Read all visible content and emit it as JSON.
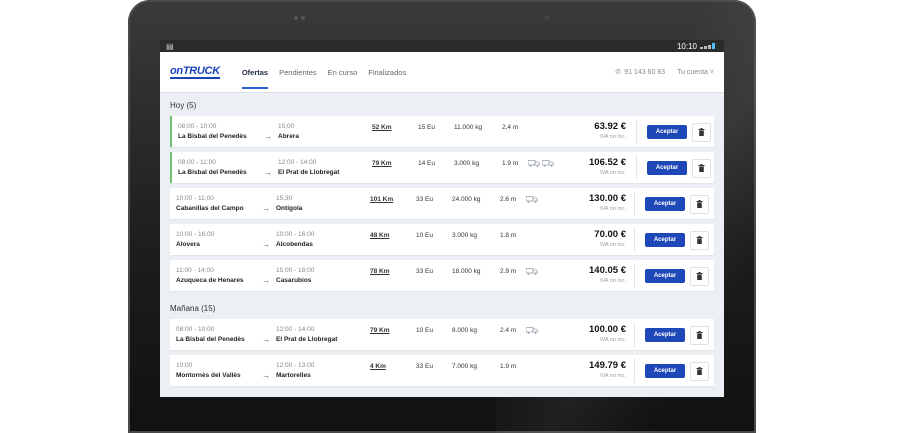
{
  "statusbar": {
    "time": "10:10"
  },
  "nav": {
    "logo": "onTRUCK",
    "tabs": [
      "Ofertas",
      "Pendientes",
      "En curso",
      "Finalizados"
    ],
    "active_tab": "Ofertas",
    "phone": "91 143 60 83",
    "account": "Tu cuenta"
  },
  "accept_label": "Aceptar",
  "colors": {
    "accent": "#1e47b8",
    "highlight": "#6fbf73",
    "background": "#eceff3"
  },
  "sections": [
    {
      "title": "Hoy (5)",
      "rows": [
        {
          "origin_time": "08:00 - 10:00",
          "origin": "La Bisbal del Penedès",
          "dest_time": "15:00",
          "dest": "Abrera",
          "distance": "52 Km",
          "price_per": "15 Eu",
          "weight": "11.000 kg",
          "length": "2,4 m",
          "trucks": 0,
          "price": "63.92 €",
          "iva": "IVA no inc.",
          "highlight": true
        },
        {
          "origin_time": "08:00 - 11:00",
          "origin": "La Bisbal del Penedès",
          "dest_time": "12:00 - 14:00",
          "dest": "El Prat de Llobregat",
          "distance": "79 Km",
          "price_per": "14 Eu",
          "weight": "3.000 kg",
          "length": "1.9 m",
          "trucks": 2,
          "price": "106.52 €",
          "iva": "IVA no inc.",
          "highlight": true
        },
        {
          "origin_time": "10:00 - 11:00",
          "origin": "Cabanillas del Campo",
          "dest_time": "15:30",
          "dest": "Ontígola",
          "distance": "101 Km",
          "price_per": "33 Eu",
          "weight": "24.000 kg",
          "length": "2.6 m",
          "trucks": 1,
          "price": "130.00 €",
          "iva": "IVA no inc.",
          "highlight": false
        },
        {
          "origin_time": "10:00 - 16:00",
          "origin": "Alovera",
          "dest_time": "10:00 - 16:00",
          "dest": "Alcobendas",
          "distance": "48 Km",
          "price_per": "10 Eu",
          "weight": "3.000 kg",
          "length": "1.8 m",
          "trucks": 0,
          "price": "70.00 €",
          "iva": "IVA no inc.",
          "highlight": false
        },
        {
          "origin_time": "11:00 - 14:00",
          "origin": "Azuqueca de Henares",
          "dest_time": "15:00 - 18:00",
          "dest": "Casarubios",
          "distance": "78 Km",
          "price_per": "33 Eu",
          "weight": "18.000 kg",
          "length": "2.9 m",
          "trucks": 1,
          "price": "140.05 €",
          "iva": "IVA no inc.",
          "highlight": false
        }
      ]
    },
    {
      "title": "Mañana (15)",
      "rows": [
        {
          "origin_time": "08:00 - 10:00",
          "origin": "La Bisbal del Penedès",
          "dest_time": "12:00 - 14:00",
          "dest": "El Prat de Llobregat",
          "distance": "79 Km",
          "price_per": "10 Eu",
          "weight": "8.000 kg",
          "length": "2.4 m",
          "trucks": 1,
          "price": "100.00  €",
          "iva": "IVA no inc.",
          "highlight": false
        },
        {
          "origin_time": "10:00",
          "origin": "Montornès del Vallès",
          "dest_time": "12:00 - 13:00",
          "dest": "Martorelles",
          "distance": "4 Km",
          "price_per": "33 Eu",
          "weight": "7.000 kg",
          "length": "1.9 m",
          "trucks": 0,
          "price": "149.79 €",
          "iva": "IVA no inc.",
          "highlight": false
        }
      ]
    }
  ]
}
